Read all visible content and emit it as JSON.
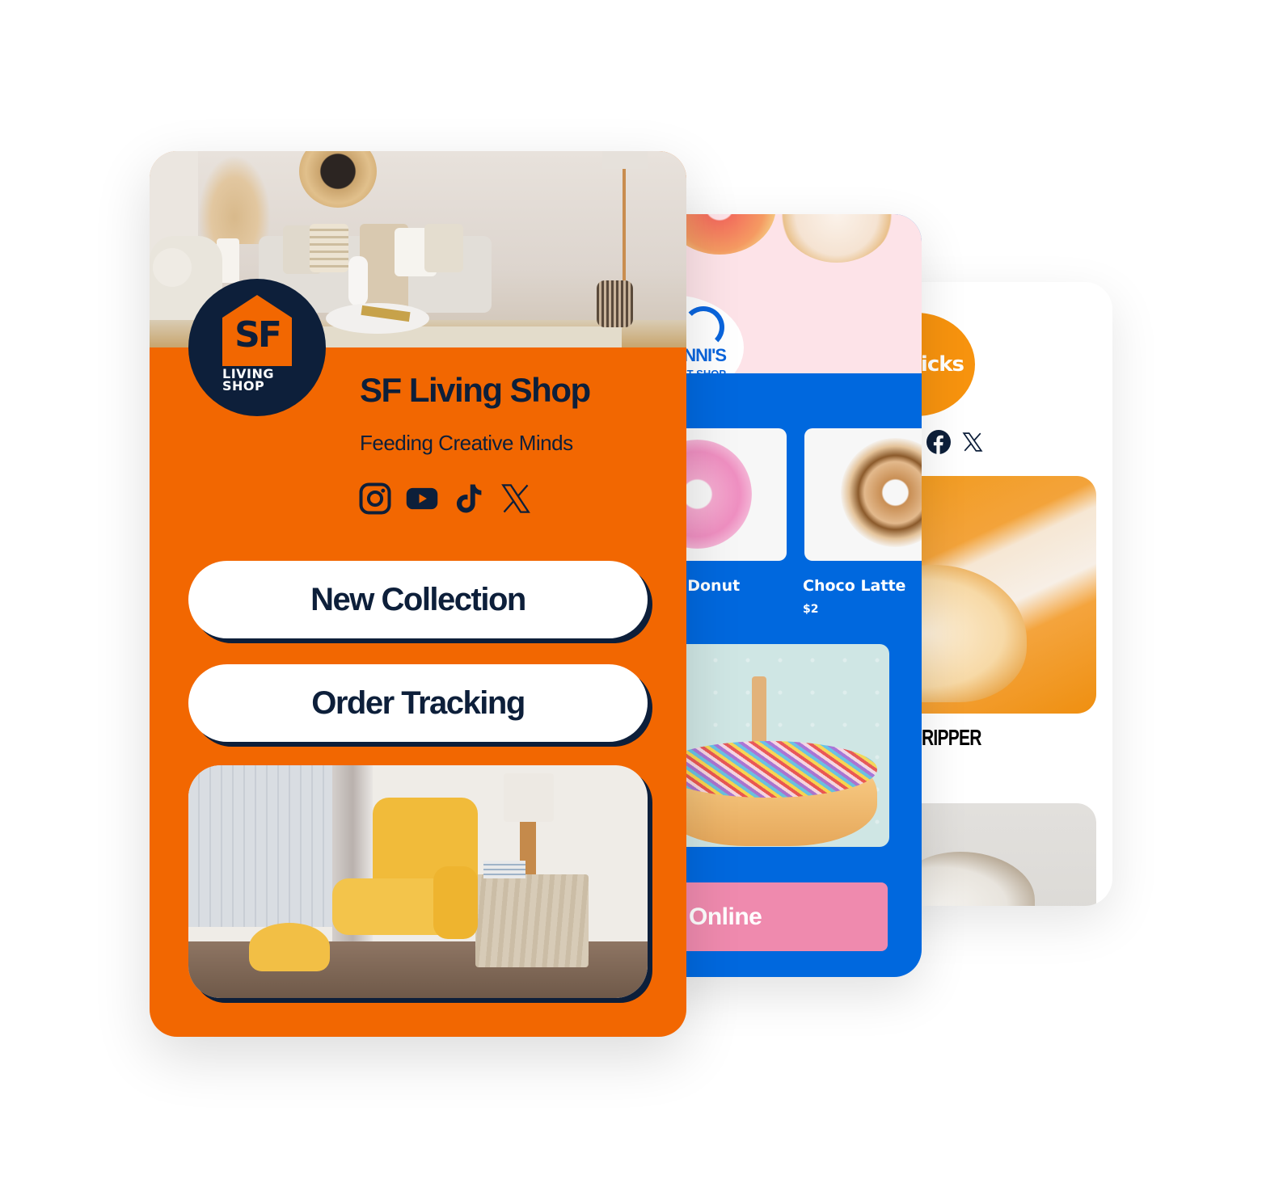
{
  "cards": {
    "sf_living": {
      "logo": {
        "mark": "SF",
        "line1": "LIVING",
        "line2": "SHOP"
      },
      "name": "SF Living Shop",
      "tagline": "Feeding Creative Minds",
      "social_icons": [
        "instagram-icon",
        "youtube-icon",
        "tiktok-icon",
        "x-icon"
      ],
      "buttons": [
        {
          "label": "New Collection"
        },
        {
          "label": "Order Tracking"
        }
      ],
      "colors": {
        "background": "#f26701",
        "navy": "#0d1f3a",
        "button": "#ffffff"
      }
    },
    "donut_shop": {
      "logo": {
        "line1": "NNI'S",
        "line2": "T SHOP"
      },
      "products": [
        {
          "name": "d Donut"
        },
        {
          "name": "Choco Latte",
          "price": "$2"
        }
      ],
      "order_button": {
        "label": "Online"
      },
      "colors": {
        "background": "#0068de",
        "hero": "#fde3e8",
        "button": "#ef8aae"
      }
    },
    "kicks": {
      "logo": {
        "text": "kicks"
      },
      "social_icons": [
        "facebook-icon",
        "x-icon"
      ],
      "product_name": "RIPPER",
      "colors": {
        "background": "#ffffff",
        "logo": "#f7930e"
      }
    }
  }
}
